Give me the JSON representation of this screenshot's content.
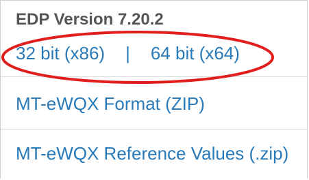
{
  "edp": {
    "version_title": "EDP Version 7.20.2",
    "link_32bit": "32 bit (x86)",
    "separator": "|",
    "link_64bit": "64 bit (x64)"
  },
  "downloads": {
    "format_zip": "MT-eWQX Format (ZIP)",
    "reference_values": "MT-eWQX Reference Values (.zip)"
  },
  "annotation": {
    "highlight_color": "#e01e1e"
  },
  "colors": {
    "link": "#2a7ab8",
    "title": "#555555",
    "border": "#cfcfcf"
  }
}
